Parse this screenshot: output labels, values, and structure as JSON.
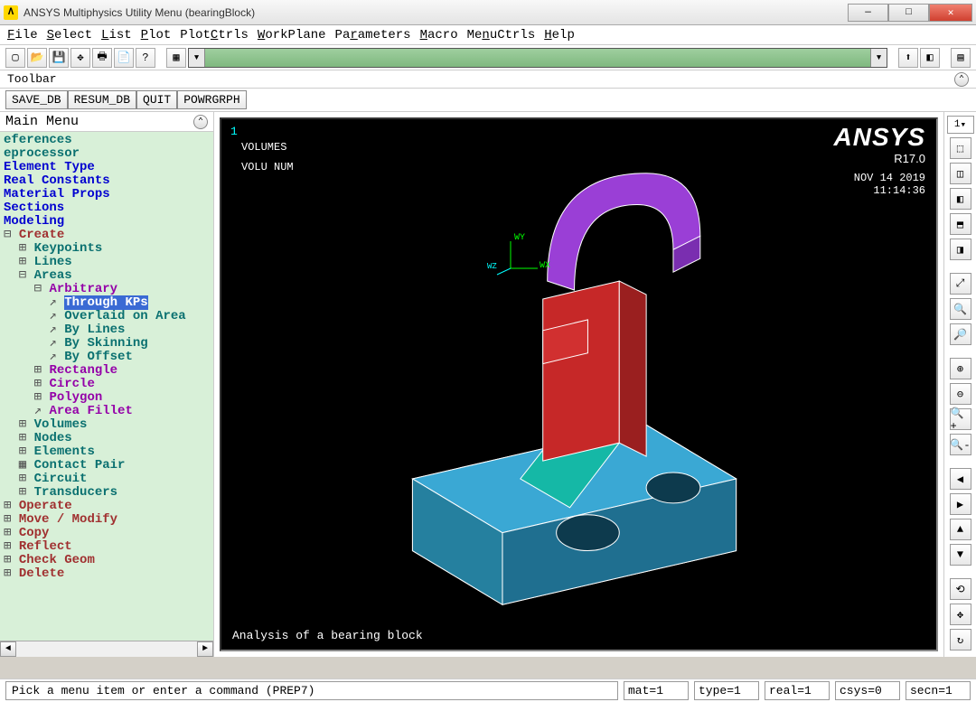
{
  "window": {
    "title": "ANSYS Multiphysics Utility Menu (bearingBlock)"
  },
  "menubar": [
    "File",
    "Select",
    "List",
    "Plot",
    "PlotCtrls",
    "WorkPlane",
    "Parameters",
    "Macro",
    "MenuCtrls",
    "Help"
  ],
  "toolbarLabel": "Toolbar",
  "cmdButtons": [
    "SAVE_DB",
    "RESUM_DB",
    "QUIT",
    "POWRGRPH"
  ],
  "mainMenu": {
    "title": "Main Menu",
    "items": [
      {
        "t": "eferences",
        "cls": "teal",
        "ind": 0,
        "sym": ""
      },
      {
        "t": "eprocessor",
        "cls": "teal",
        "ind": 0,
        "sym": ""
      },
      {
        "t": "Element Type",
        "cls": "blue",
        "ind": 0,
        "sym": ""
      },
      {
        "t": "Real Constants",
        "cls": "blue",
        "ind": 0,
        "sym": ""
      },
      {
        "t": "Material Props",
        "cls": "blue",
        "ind": 0,
        "sym": ""
      },
      {
        "t": "Sections",
        "cls": "blue",
        "ind": 0,
        "sym": ""
      },
      {
        "t": "Modeling",
        "cls": "blue",
        "ind": 0,
        "sym": ""
      },
      {
        "t": "Create",
        "cls": "darkred",
        "ind": 0,
        "sym": "⊟ "
      },
      {
        "t": "Keypoints",
        "cls": "teal",
        "ind": 1,
        "sym": "⊞ "
      },
      {
        "t": "Lines",
        "cls": "teal",
        "ind": 1,
        "sym": "⊞ "
      },
      {
        "t": "Areas",
        "cls": "teal",
        "ind": 1,
        "sym": "⊟ "
      },
      {
        "t": "Arbitrary",
        "cls": "purple",
        "ind": 2,
        "sym": "⊟ "
      },
      {
        "t": "Through KPs",
        "cls": "teal",
        "ind": 3,
        "sym": "↗ ",
        "sel": true
      },
      {
        "t": "Overlaid on Area",
        "cls": "teal",
        "ind": 3,
        "sym": "↗ "
      },
      {
        "t": "By Lines",
        "cls": "teal",
        "ind": 3,
        "sym": "↗ "
      },
      {
        "t": "By Skinning",
        "cls": "teal",
        "ind": 3,
        "sym": "↗ "
      },
      {
        "t": "By Offset",
        "cls": "teal",
        "ind": 3,
        "sym": "↗ "
      },
      {
        "t": "Rectangle",
        "cls": "purple",
        "ind": 2,
        "sym": "⊞ "
      },
      {
        "t": "Circle",
        "cls": "purple",
        "ind": 2,
        "sym": "⊞ "
      },
      {
        "t": "Polygon",
        "cls": "purple",
        "ind": 2,
        "sym": "⊞ "
      },
      {
        "t": "Area Fillet",
        "cls": "purple",
        "ind": 2,
        "sym": "↗ "
      },
      {
        "t": "Volumes",
        "cls": "teal",
        "ind": 1,
        "sym": "⊞ "
      },
      {
        "t": "Nodes",
        "cls": "teal",
        "ind": 1,
        "sym": "⊞ "
      },
      {
        "t": "Elements",
        "cls": "teal",
        "ind": 1,
        "sym": "⊞ "
      },
      {
        "t": "Contact Pair",
        "cls": "teal",
        "ind": 1,
        "sym": "▦ "
      },
      {
        "t": "Circuit",
        "cls": "teal",
        "ind": 1,
        "sym": "⊞ "
      },
      {
        "t": "Transducers",
        "cls": "teal",
        "ind": 1,
        "sym": "⊞ "
      },
      {
        "t": "Operate",
        "cls": "darkred",
        "ind": 0,
        "sym": "⊞ "
      },
      {
        "t": "Move / Modify",
        "cls": "darkred",
        "ind": 0,
        "sym": "⊞ "
      },
      {
        "t": "Copy",
        "cls": "darkred",
        "ind": 0,
        "sym": "⊞ "
      },
      {
        "t": "Reflect",
        "cls": "darkred",
        "ind": 0,
        "sym": "⊞ "
      },
      {
        "t": "Check Geom",
        "cls": "darkred",
        "ind": 0,
        "sym": "⊞ "
      },
      {
        "t": "Delete",
        "cls": "darkred",
        "ind": 0,
        "sym": "⊞ "
      }
    ]
  },
  "viewport": {
    "cornerNum": "1",
    "label1": "VOLUMES",
    "label2": "VOLU NUM",
    "brand": "ANSYS",
    "version": "R17.0",
    "date": "NOV 14 2019",
    "time": "11:14:36",
    "axes": {
      "y": "WY",
      "x": "WX",
      "z": "WZ"
    },
    "caption": "Analysis of a bearing block"
  },
  "rightDropdown": "1",
  "status": {
    "prompt": "Pick a menu item or enter a command (PREP7)",
    "mat": "mat=1",
    "type": "type=1",
    "real": "real=1",
    "csys": "csys=0",
    "secn": "secn=1"
  }
}
